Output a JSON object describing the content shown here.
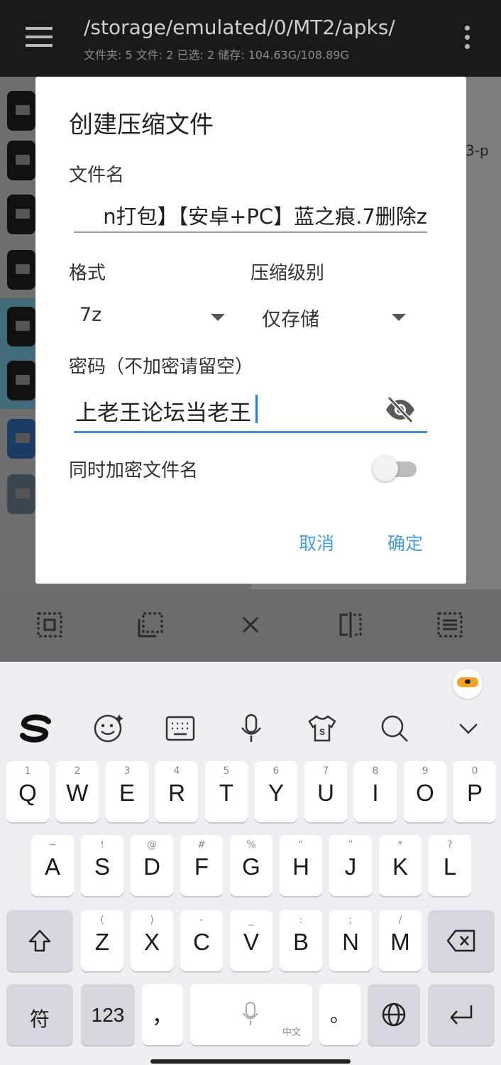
{
  "appbar": {
    "path": "/storage/emulated/0/MT2/apks/",
    "stats": "文件夹: 5  文件: 2  已选: 2  储存: 104.63G/108.89G"
  },
  "background": {
    "tail_text": "3-p"
  },
  "dialog": {
    "title": "创建压缩文件",
    "filename_label": "文件名",
    "filename_value": "n打包】【安卓+PC】蓝之痕.7删除z",
    "format_label": "格式",
    "format_value": "7z",
    "level_label": "压缩级别",
    "level_value": "仅存储",
    "password_label": "密码（不加密请留空）",
    "password_value": "上老王论坛当老王",
    "encrypt_names_label": "同时加密文件名",
    "encrypt_names_on": false,
    "cancel_label": "取消",
    "ok_label": "确定"
  },
  "keyboard": {
    "row1": [
      {
        "k": "Q",
        "s": "1"
      },
      {
        "k": "W",
        "s": "2"
      },
      {
        "k": "E",
        "s": "3"
      },
      {
        "k": "R",
        "s": "4"
      },
      {
        "k": "T",
        "s": "5"
      },
      {
        "k": "Y",
        "s": "6"
      },
      {
        "k": "U",
        "s": "7"
      },
      {
        "k": "I",
        "s": "8"
      },
      {
        "k": "O",
        "s": "9"
      },
      {
        "k": "P",
        "s": "0"
      }
    ],
    "row2": [
      {
        "k": "A",
        "s": "~"
      },
      {
        "k": "S",
        "s": "!"
      },
      {
        "k": "D",
        "s": "@"
      },
      {
        "k": "F",
        "s": "#"
      },
      {
        "k": "G",
        "s": "%"
      },
      {
        "k": "H",
        "s": "“"
      },
      {
        "k": "J",
        "s": "”"
      },
      {
        "k": "K",
        "s": "*"
      },
      {
        "k": "L",
        "s": "?"
      }
    ],
    "row3": [
      {
        "k": "Z",
        "s": "("
      },
      {
        "k": "X",
        "s": ")"
      },
      {
        "k": "C",
        "s": "-"
      },
      {
        "k": "V",
        "s": "_"
      },
      {
        "k": "B",
        "s": ":"
      },
      {
        "k": "N",
        "s": ";"
      },
      {
        "k": "M",
        "s": "/"
      }
    ],
    "symbol_key": "符",
    "num_key": "123",
    "comma_key": "，",
    "period_key": "。",
    "space_hint": "中文"
  }
}
